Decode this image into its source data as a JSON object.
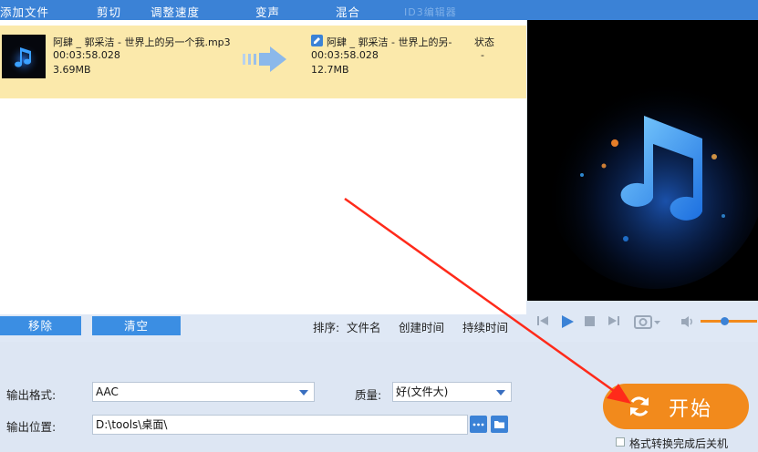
{
  "toolbar": {
    "add_file": "添加文件",
    "cut": "剪切",
    "adjust_speed": "调整速度",
    "voice_change": "变声",
    "mix": "混合",
    "id3_editor": "ID3编辑器"
  },
  "file": {
    "source_name": "阿肆 _ 郭采洁 - 世界上的另一个我.mp3",
    "source_duration": "00:03:58.028",
    "source_size": "3.69MB",
    "output_name": "阿肆 _ 郭采洁 - 世界上的另-",
    "output_duration": "00:03:58.028",
    "output_size": "12.7MB",
    "status_label": "状态",
    "status_value": "-"
  },
  "list_buttons": {
    "remove": "移除",
    "clear": "清空"
  },
  "sort": {
    "label": "排序:",
    "by_name": "文件名",
    "by_created": "创建时间",
    "by_duration": "持续时间"
  },
  "player": {
    "volume_level": 0.42,
    "icons": [
      "prev-icon",
      "play-icon",
      "stop-icon",
      "next-icon",
      "snapshot-icon",
      "volume-icon"
    ]
  },
  "output": {
    "format_label": "输出格式:",
    "format_value": "AAC",
    "quality_label": "质量:",
    "quality_value": "好(文件大)",
    "location_label": "输出位置:",
    "location_value": "D:\\tools\\桌面\\"
  },
  "start": {
    "label": "开始",
    "shutdown_label": "格式转换完成后关机",
    "shutdown_checked": false
  },
  "colors": {
    "toolbar": "#3b82d6",
    "row_highlight": "#fbe9ab",
    "start_button": "#f28a1c",
    "annotation_arrow": "#ff2a1a"
  }
}
